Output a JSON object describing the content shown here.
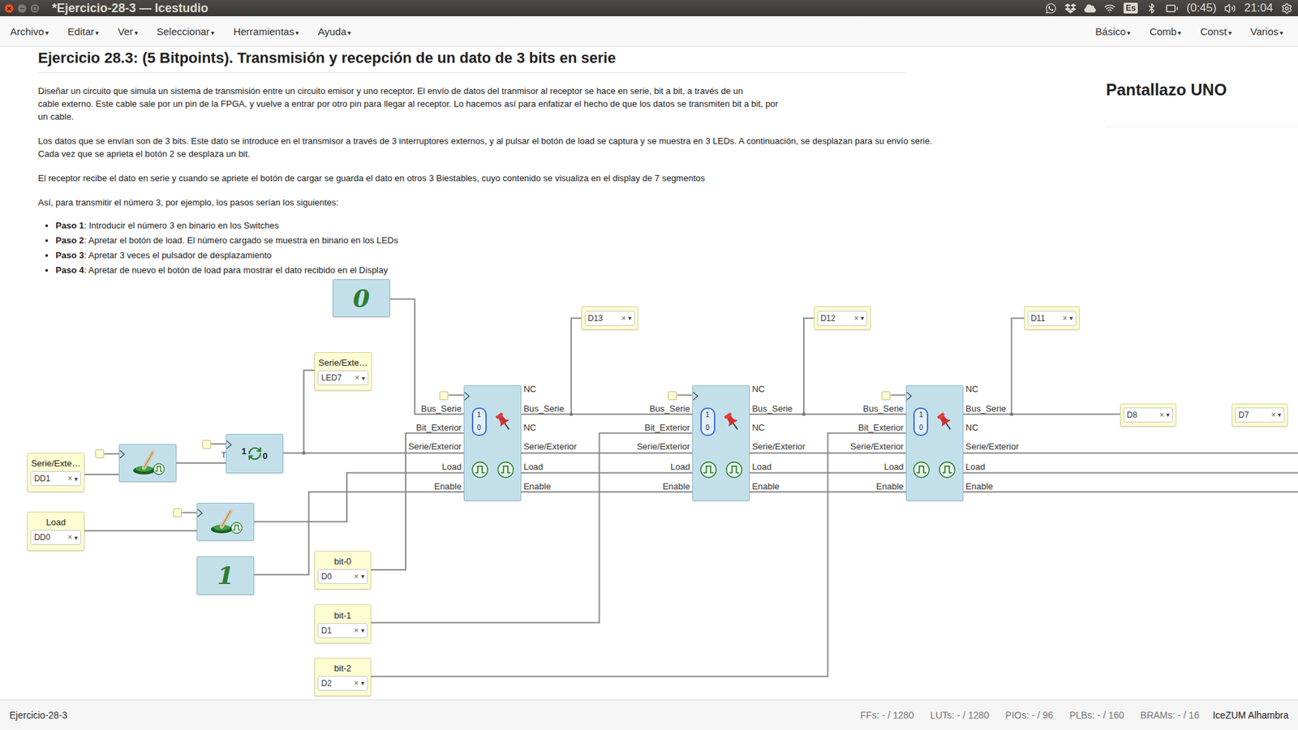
{
  "window": {
    "title": "*Ejercicio-28-3 — Icestudio"
  },
  "tray": {
    "keyboard": "Es",
    "battery": "(0:45)",
    "clock": "21:04"
  },
  "menu": {
    "caret": "▾",
    "left": [
      "Archivo",
      "Editar",
      "Ver",
      "Seleccionar",
      "Herramientas",
      "Ayuda"
    ],
    "right": [
      "Básico",
      "Comb",
      "Const",
      "Varios"
    ]
  },
  "info": {
    "title": "Ejercicio 28.3: (5 Bitpoints). Transmisión y recepción de un dato de 3 bits en serie",
    "paragraphs": [
      [
        "Diseñar un circuito que simula un sistema de transmisión entre un circuito emisor y uno receptor. El envío de datos del tranmisor al receptor se hace en serie, bit a bit, a través de un",
        "cable externo. Este cable sale por un pin de la FPGA, y vuelve a entrar por otro pin para llegar al receptor. Lo hacemos así para enfatizar el hecho de que los datos se transmiten bit a bit, por",
        "un cable."
      ],
      [
        "Los datos que se envían son de 3 bits. Este dato se introduce en el transmisor a través de 3 interruptores externos, y al pulsar el botón de load se captura y se muestra en 3 LEDs. A continuación, se desplazan para su envío serie.",
        "Cada vez que se aprieta el botón 2 se desplaza un bit."
      ],
      [
        "El receptor recibe el dato en serie y cuando se apriete el botón de cargar se guarda el dato en otros 3 Biestables, cuyo contenido se visualiza en el display de 7 segmentos"
      ],
      [
        "Así, para transmitir el número 3, por ejemplo, los pasos serían los siguientes:"
      ]
    ],
    "steps": [
      {
        "label": "Paso 1",
        "text": ": Introducir el número 3 en binario en los Switches"
      },
      {
        "label": "Paso 2",
        "text": ": Apretar el botón de load. El número cargado se muestra en binario en los LEDs"
      },
      {
        "label": "Paso 3",
        "text": ": Apretar 3 veces el pulsador de desplazamiento"
      },
      {
        "label": "Paso 4",
        "text": ": Apretar de nuevo el botón de load para mostrar el dato recibido en el Display"
      }
    ]
  },
  "note": {
    "title": "Pantallazo UNO"
  },
  "diagram": {
    "clear": "×",
    "arrow": "▾",
    "pins": [
      {
        "kind": "labeled",
        "label": "Serie/Exte…",
        "value": "LED7"
      },
      {
        "kind": "labeled",
        "label": "Serie/Exte…",
        "value": "DD1"
      },
      {
        "kind": "labeled",
        "label": "Load",
        "value": "DD0"
      },
      {
        "kind": "labeled",
        "label": "bit-0",
        "value": "D0"
      },
      {
        "kind": "labeled",
        "label": "bit-1",
        "value": "D1"
      },
      {
        "kind": "labeled",
        "label": "bit-2",
        "value": "D2"
      },
      {
        "kind": "compact",
        "value": "D13"
      },
      {
        "kind": "compact",
        "value": "D12"
      },
      {
        "kind": "compact",
        "value": "D11"
      },
      {
        "kind": "compact",
        "value": "D8"
      },
      {
        "kind": "compact",
        "value": "D7"
      }
    ],
    "blocks": [
      {
        "kind": "constant",
        "glyph": "0"
      },
      {
        "kind": "button"
      },
      {
        "kind": "toggle",
        "high": "1",
        "low": "0",
        "input": "T"
      },
      {
        "kind": "button"
      },
      {
        "kind": "constant",
        "glyph": "1"
      }
    ],
    "registers": [
      {
        "inputs": [
          "Bus_Serie",
          "Bit_Exterior",
          "Serie/Exterior",
          "Load",
          "Enable"
        ],
        "outputs": [
          "NC",
          "Bus_Serie",
          "NC",
          "Serie/Exterior",
          "Load",
          "Enable"
        ],
        "mux_top": "1",
        "mux_bottom": "0"
      },
      {
        "inputs": [
          "Bus_Serie",
          "Bit_Exterior",
          "Serie/Exterior",
          "Load",
          "Enable"
        ],
        "outputs": [
          "NC",
          "Bus_Serie",
          "NC",
          "Serie/Exterior",
          "Load",
          "Enable"
        ],
        "mux_top": "1",
        "mux_bottom": "0"
      },
      {
        "inputs": [
          "Bus_Serie",
          "Bit_Exterior",
          "Serie/Exterior",
          "Load",
          "Enable"
        ],
        "outputs": [
          "NC",
          "Bus_Serie",
          "NC",
          "Serie/Exterior",
          "Load",
          "Enable"
        ],
        "mux_top": "1",
        "mux_bottom": "0"
      }
    ]
  },
  "status_bar": {
    "project": "Ejercicio-28-3",
    "stats": [
      "FFs: - / 1280",
      "LUTs: - / 1280",
      "PIOs: - / 96",
      "PLBs: - / 160",
      "BRAMs: - / 16"
    ],
    "board": "IceZUM Alhambra"
  }
}
